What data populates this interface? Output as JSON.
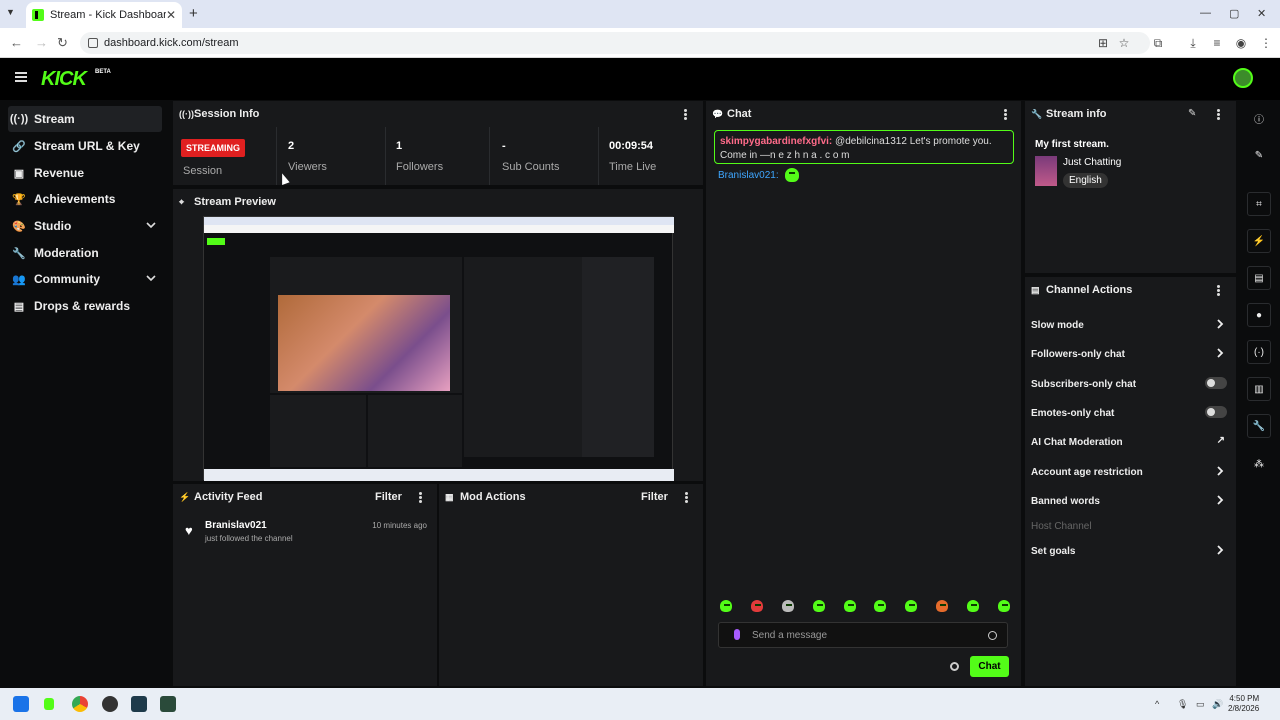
{
  "browser": {
    "tab_title": "Stream - Kick Dashboard",
    "new_tab": "+",
    "url": "dashboard.kick.com/stream",
    "min": "—",
    "max": "▢",
    "close": "✕"
  },
  "topbar": {
    "logo": "KICK",
    "beta": "BETA"
  },
  "sidebar": {
    "items": [
      {
        "label": "Stream",
        "icon": "broadcast-icon"
      },
      {
        "label": "Stream URL & Key",
        "icon": "link-icon"
      },
      {
        "label": "Revenue",
        "icon": "revenue-icon"
      },
      {
        "label": "Achievements",
        "icon": "trophy-icon"
      },
      {
        "label": "Studio",
        "icon": "palette-icon"
      },
      {
        "label": "Moderation",
        "icon": "wrench-icon"
      },
      {
        "label": "Community",
        "icon": "people-icon"
      },
      {
        "label": "Drops & rewards",
        "icon": "gift-icon"
      }
    ]
  },
  "session": {
    "title": "Session Info",
    "badge": "STREAMING",
    "session_label": "Session",
    "stats": [
      {
        "value": "2",
        "label": "Viewers"
      },
      {
        "value": "1",
        "label": "Followers"
      },
      {
        "value": "-",
        "label": "Sub Counts"
      },
      {
        "value": "00:09:54",
        "label": "Time Live"
      }
    ]
  },
  "preview": {
    "title": "Stream Preview"
  },
  "activity": {
    "title": "Activity Feed",
    "filter": "Filter",
    "items": [
      {
        "user": "Branislav021",
        "text": "just followed the channel",
        "time": "10 minutes ago"
      }
    ]
  },
  "mod_actions": {
    "title": "Mod Actions",
    "filter": "Filter"
  },
  "chat": {
    "title": "Chat",
    "messages": [
      {
        "user": "skimpygabardinefxgfvi:",
        "text": "@debilcina1312 Let's promote you. Come in —n e z h n a . c o m"
      },
      {
        "user": "Branislav021:",
        "text": ""
      }
    ],
    "placeholder": "Send a message",
    "send": "Chat"
  },
  "stream_info": {
    "title": "Stream info",
    "stream_title": "My first stream.",
    "category": "Just Chatting",
    "language": "English"
  },
  "channel_actions": {
    "title": "Channel Actions",
    "items": [
      {
        "label": "Slow mode",
        "control": "arrow"
      },
      {
        "label": "Followers-only chat",
        "control": "arrow"
      },
      {
        "label": "Subscribers-only chat",
        "control": "toggle",
        "enabled": false
      },
      {
        "label": "Emotes-only chat",
        "control": "toggle",
        "enabled": false
      },
      {
        "label": "AI Chat Moderation",
        "control": "external"
      },
      {
        "label": "Account age restriction",
        "control": "arrow"
      },
      {
        "label": "Banned words",
        "control": "arrow"
      },
      {
        "label": "Host Channel",
        "control": "none",
        "disabled": true
      },
      {
        "label": "Set goals",
        "control": "arrow"
      }
    ]
  },
  "taskbar": {
    "time": "4:50 PM",
    "date": "2/8/2026"
  },
  "colors": {
    "accent": "#53fc18",
    "streaming_badge": "#e02020",
    "panel": "#18191b",
    "background": "#0b0c0d"
  }
}
